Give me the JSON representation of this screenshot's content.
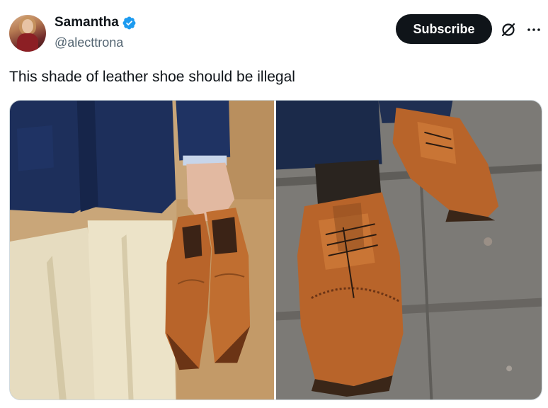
{
  "author": {
    "display_name": "Samantha",
    "handle": "@alecttrona",
    "verified": true,
    "verified_color": "#1d9bf0"
  },
  "actions": {
    "subscribe_label": "Subscribe",
    "grok_icon": "grok-icon",
    "more_icon": "more-icon"
  },
  "tweet": {
    "text": "This shade of leather shoe should be illegal"
  },
  "media": {
    "count": 2,
    "accent_shoe_color": "#b8642a"
  }
}
